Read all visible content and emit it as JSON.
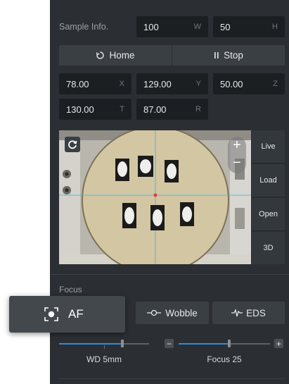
{
  "sample_info": {
    "label": "Sample Info.",
    "width_value": "100",
    "width_unit": "W",
    "height_value": "50",
    "height_unit": "H"
  },
  "actions": {
    "home_label": "Home",
    "stop_label": "Stop"
  },
  "stage": {
    "x": {
      "value": "78.00",
      "unit": "X"
    },
    "y": {
      "value": "129.00",
      "unit": "Y"
    },
    "z": {
      "value": "50.00",
      "unit": "Z"
    },
    "t": {
      "value": "130.00",
      "unit": "T"
    },
    "r": {
      "value": "87.00",
      "unit": "R"
    }
  },
  "viewer": {
    "zoom_in": "+",
    "zoom_out": "−"
  },
  "side_buttons": {
    "live": "Live",
    "load": "Load",
    "open": "Open",
    "three_d": "3D"
  },
  "focus": {
    "section_label": "Focus",
    "af_label": "AF",
    "wobble_label": "Wobble",
    "eds_label": "EDS",
    "wd_label": "WD 5mm",
    "wd_level": 0.7,
    "focus_label": "Focus 25",
    "focus_level": 0.55,
    "minus": "−",
    "plus": "+"
  },
  "colors": {
    "panel": "#2b2f33",
    "field": "#1c1f22",
    "accent": "#2e8bd9"
  },
  "icons": [
    "refresh-icon",
    "pause-icon",
    "rotate-icon",
    "zoom-in-icon",
    "zoom-out-icon",
    "af-target-icon",
    "wobble-icon",
    "eds-signal-icon"
  ]
}
